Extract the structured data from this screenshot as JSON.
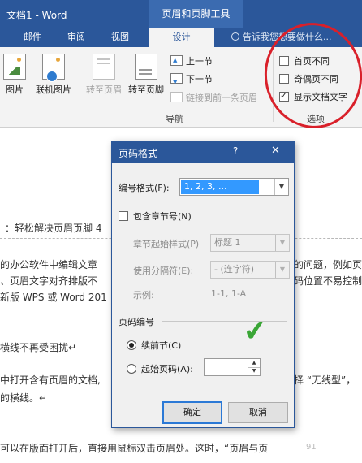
{
  "titlebar": {
    "doc_title": "文档1 - Word",
    "context_title": "页眉和页脚工具"
  },
  "tabs": [
    {
      "label": "邮件"
    },
    {
      "label": "审阅"
    },
    {
      "label": "视图"
    },
    {
      "label": "设计"
    }
  ],
  "tellme": {
    "text": "告诉我您想要做什么..."
  },
  "ribbon": {
    "insert": {
      "picture": "图片",
      "online_picture": "联机图片"
    },
    "nav": {
      "goto_header": "转至页眉",
      "goto_footer": "转至页脚",
      "prev_section": "上一节",
      "next_section": "下一节",
      "link_previous": "链接到前一条页眉",
      "group_label": "导航"
    },
    "options": {
      "first_page": "首页不同",
      "odd_even": "奇偶页不同",
      "show_doc_text": "显示文档文字",
      "group_label": "选项",
      "first_page_checked": false,
      "odd_even_checked": false,
      "show_doc_text_checked": true
    }
  },
  "doc": {
    "lines": [
      "：轻松解决页眉页脚 4",
      "的办公软件中编辑文章",
      "、页眉文字对齐排版不",
      "新版 WPS 或 Word 201",
      "横线不再受困扰↵",
      "中打开含有页眉的文档,",
      "的横线。↵",
      "可以在版面打开后，直接用鼠标双击页眉处。这时，“页眉与页",
      "的问题，例如页",
      "码位置不易控制",
      "择 “无线型”，"
    ],
    "watermark": "91"
  },
  "dialog": {
    "title": "页码格式",
    "help": "?",
    "close": "✕",
    "number_format_label": "编号格式(F):",
    "number_format_value": "1, 2, 3, ...",
    "include_chapter_label": "包含章节号(N)",
    "chapter_start_label": "章节起始样式(P)",
    "chapter_start_value": "标题 1",
    "separator_label": "使用分隔符(E):",
    "separator_value": "-   (连字符)",
    "example_label": "示例:",
    "example_value": "1-1, 1-A",
    "numbering_section": "页码编号",
    "continue_label": "续前节(C)",
    "start_at_label": "起始页码(A):",
    "ok": "确定",
    "cancel": "取消"
  },
  "colors": {
    "word_blue": "#2b579a",
    "annotation_red": "#d9202a",
    "check_green": "#3aa636"
  }
}
